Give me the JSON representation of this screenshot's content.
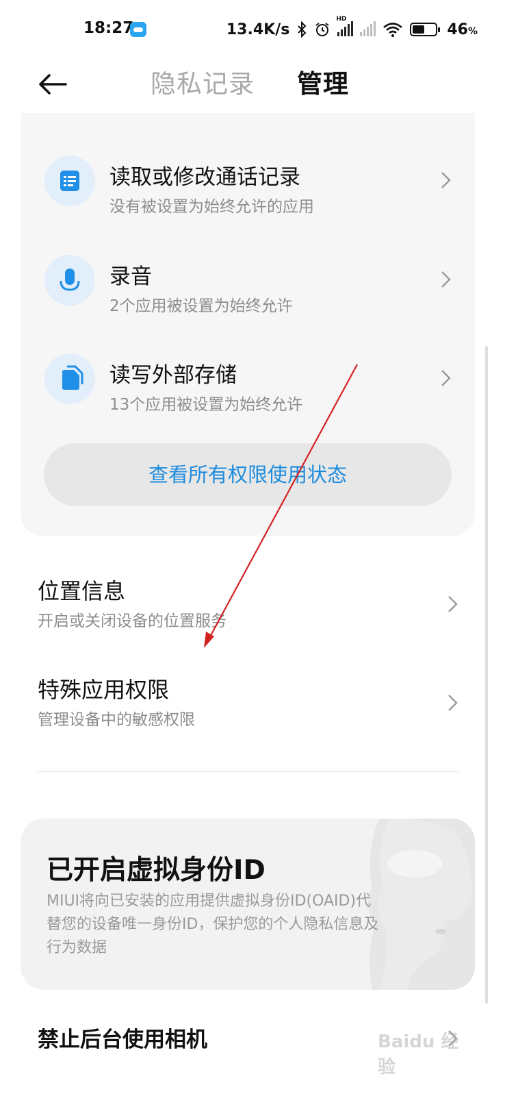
{
  "status_bar": {
    "time": "18:27",
    "speed": "13.4K/s",
    "hd_label": "HD",
    "battery_percent": "46",
    "battery_unit": "%",
    "icons": [
      "cloud-icon",
      "bluetooth-icon",
      "alarm-icon",
      "signal-icon",
      "wifi-icon",
      "battery-icon"
    ]
  },
  "header": {
    "tab_privacy": "隐私记录",
    "tab_manage": "管理",
    "active_tab": "管理"
  },
  "card": {
    "items": [
      {
        "title": "读取或修改通话记录",
        "subtitle": "没有被设置为始终允许的应用",
        "icon": "call-log-icon"
      },
      {
        "title": "录音",
        "subtitle": "2个应用被设置为始终允许",
        "icon": "microphone-icon"
      },
      {
        "title": "读写外部存储",
        "subtitle": "13个应用被设置为始终允许",
        "icon": "storage-icon"
      }
    ],
    "view_all_label": "查看所有权限使用状态"
  },
  "list": {
    "location": {
      "title": "位置信息",
      "subtitle": "开启或关闭设备的位置服务"
    },
    "special": {
      "title": "特殊应用权限",
      "subtitle": "管理设备中的敏感权限"
    }
  },
  "oaid": {
    "title": "已开启虚拟身份ID",
    "desc_line1": "MIUI将向已安装的应用提供虚拟身份ID(OAID)代",
    "desc_line2": "替您的设备唯一身份ID，保护您的个人隐私信息及",
    "desc_line3": "行为数据"
  },
  "bottom": {
    "camera_block": "禁止后台使用相机"
  },
  "watermark": "Baidu 经验",
  "colors": {
    "accent": "#1e8cde",
    "icon_bg": "#e3eefb",
    "icon_fg": "#1f8fe8",
    "annotation": "#d32020"
  }
}
